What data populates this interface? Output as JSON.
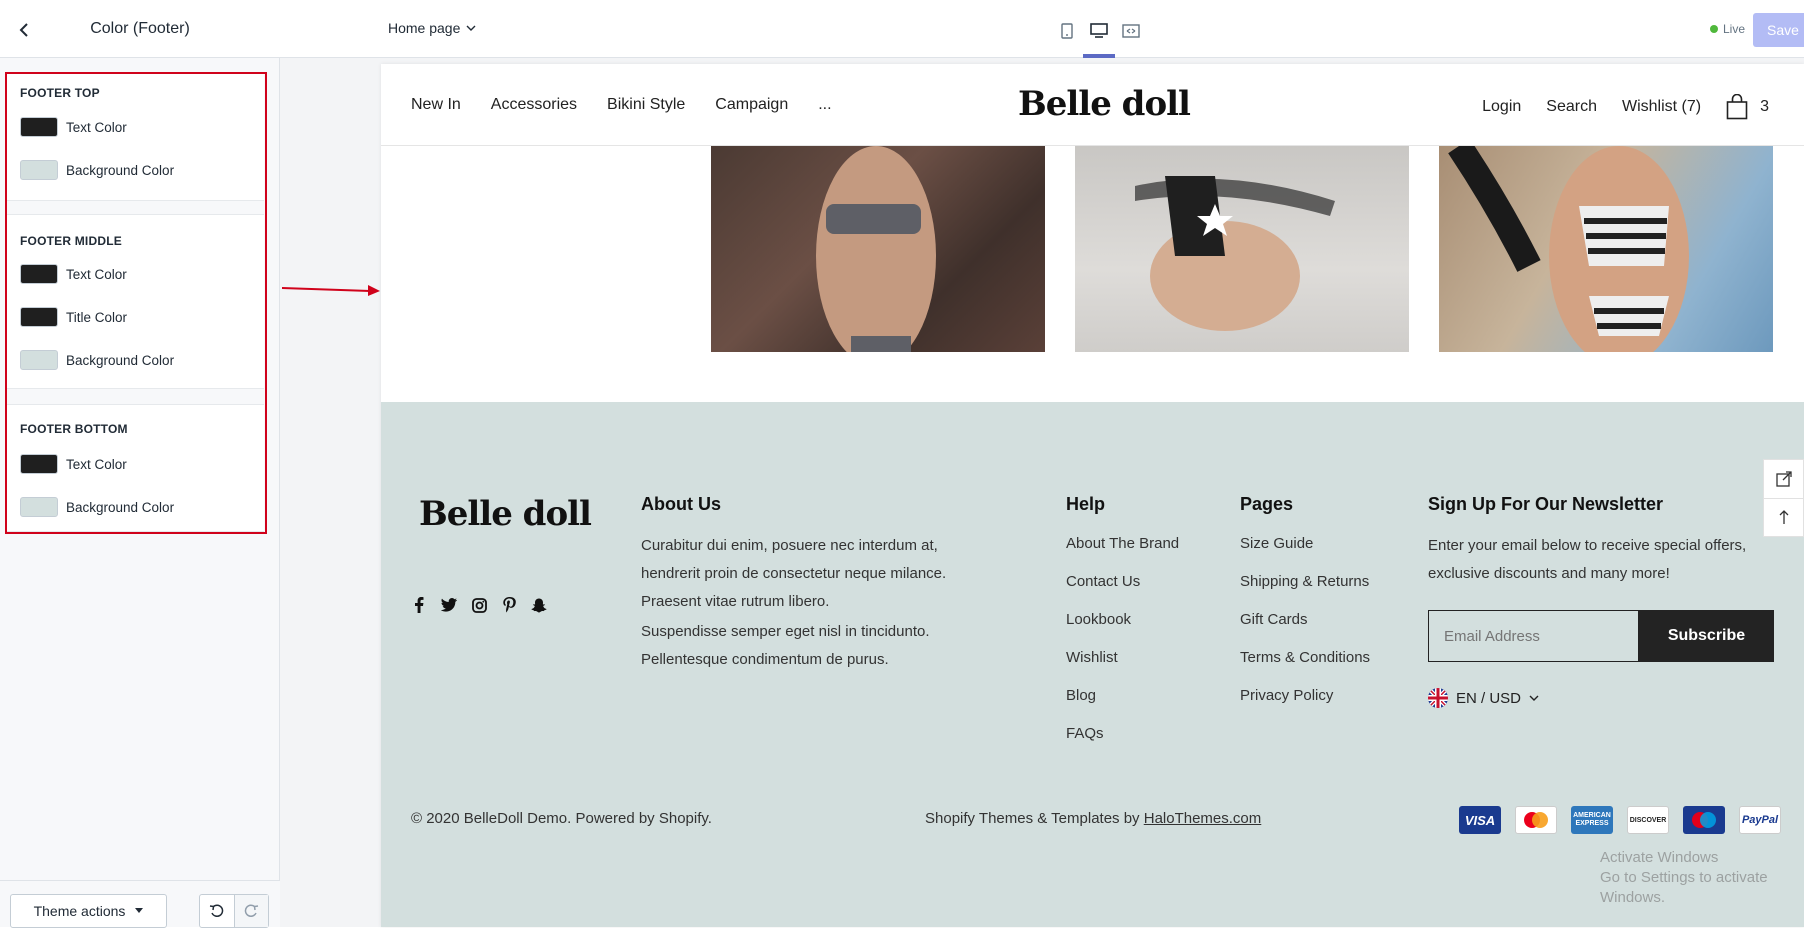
{
  "editor": {
    "panel_title": "Color (Footer)",
    "page_selector": "Home page",
    "live_label": "Live",
    "save_label": "Save",
    "theme_actions_label": "Theme actions"
  },
  "sections": [
    {
      "title": "FOOTER TOP",
      "rows": [
        {
          "label": "Text Color",
          "color": "#1f1f1f"
        },
        {
          "label": "Background Color",
          "color": "#d3dfde"
        }
      ]
    },
    {
      "title": "FOOTER MIDDLE",
      "rows": [
        {
          "label": "Text Color",
          "color": "#1f1f1f"
        },
        {
          "label": "Title Color",
          "color": "#1f1f1f"
        },
        {
          "label": "Background Color",
          "color": "#d3dfde"
        }
      ]
    },
    {
      "title": "FOOTER BOTTOM",
      "rows": [
        {
          "label": "Text Color",
          "color": "#1f1f1f"
        },
        {
          "label": "Background Color",
          "color": "#d3dfde"
        }
      ]
    }
  ],
  "store": {
    "logo": "Belle doll",
    "nav": [
      "New In",
      "Accessories",
      "Bikini Style",
      "Campaign",
      "..."
    ],
    "login": "Login",
    "search": "Search",
    "wishlist": "Wishlist (7)",
    "cart_count": "3"
  },
  "footer": {
    "background": "#d3dfde",
    "logo": "Belle doll",
    "about_title": "About Us",
    "about_p1": "Curabitur dui enim, posuere nec interdum at, hendrerit proin de consectetur neque milance. Praesent vitae rutrum libero.",
    "about_p2": "Suspendisse semper eget nisl in tincidunto. Pellentesque condimentum de purus.",
    "help_title": "Help",
    "help_links": [
      "About The Brand",
      "Contact Us",
      "Lookbook",
      "Wishlist",
      "Blog",
      "FAQs"
    ],
    "pages_title": "Pages",
    "pages_links": [
      "Size Guide",
      "Shipping & Returns",
      "Gift Cards",
      "Terms & Conditions",
      "Privacy Policy"
    ],
    "newsletter_title": "Sign Up For Our Newsletter",
    "newsletter_text": "Enter your email below to receive special offers, exclusive discounts and many more!",
    "email_placeholder": "Email Address",
    "subscribe_label": "Subscribe",
    "currency": "EN / USD",
    "copyright": "© 2020 BelleDoll Demo. Powered by Shopify.",
    "credits_prefix": "Shopify Themes & Templates by ",
    "credits_link": "HaloThemes.com",
    "payments": [
      {
        "name": "VISA",
        "color": "#1a3a8f"
      },
      {
        "name": "MasterCard",
        "color": "#ffffff"
      },
      {
        "name": "AMERICAN EXPRESS",
        "color": "#2e77bb"
      },
      {
        "name": "DISCOVER",
        "color": "#ffffff"
      },
      {
        "name": "Maestro",
        "color": "#1a3a8f"
      },
      {
        "name": "PayPal",
        "color": "#ffffff"
      }
    ]
  },
  "watermark": {
    "line1": "Activate Windows",
    "line2": "Go to Settings to activate Windows."
  }
}
